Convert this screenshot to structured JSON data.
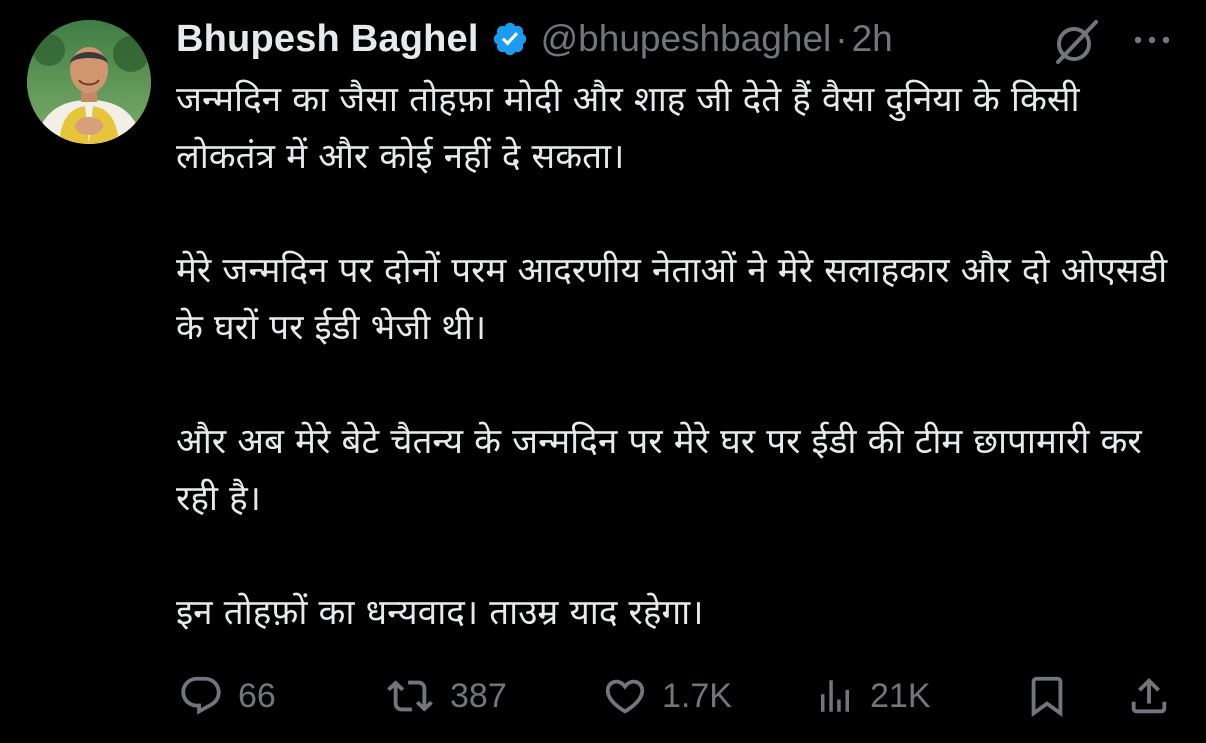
{
  "user": {
    "display_name": "Bhupesh Baghel",
    "handle": "@bhupeshbaghel",
    "separator": "·",
    "time": "2h",
    "verified_color": "#1d9bf0"
  },
  "tweet": {
    "paragraphs": [
      "जन्मदिन का जैसा तोहफ़ा मोदी और शाह जी देते हैं वैसा दुनिया के किसी लोकतंत्र में और कोई नहीं दे सकता।",
      "मेरे जन्मदिन पर दोनों परम आदरणीय नेताओं ने मेरे सलाहकार और दो ओएसडी के घरों पर ईडी भेजी थी।",
      "और अब मेरे बेटे चैतन्य के जन्मदिन पर मेरे घर पर ईडी की टीम छापामारी कर रही है।",
      "इन तोहफ़ों का धन्यवाद। ताउम्र याद रहेगा।"
    ]
  },
  "actions": {
    "replies": "66",
    "reposts": "387",
    "likes": "1.7K",
    "views": "21K"
  },
  "icons": {
    "reply": "reply-icon",
    "repost": "repost-icon",
    "like": "heart-icon",
    "views": "views-icon",
    "bookmark": "bookmark-icon",
    "share": "share-icon",
    "grok": "grok-icon",
    "more": "more-icon"
  },
  "colors": {
    "background": "#000000",
    "text": "#e7e9ea",
    "muted": "#71767b"
  }
}
